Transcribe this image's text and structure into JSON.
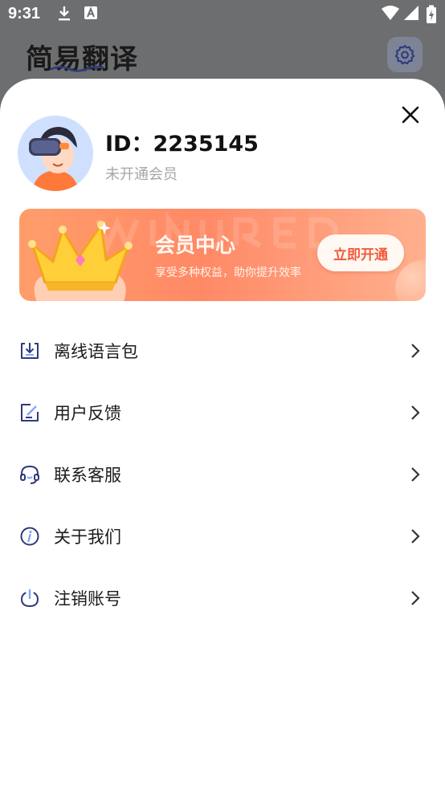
{
  "status_bar": {
    "time": "9:31",
    "icons": [
      "download-icon",
      "text-a-icon",
      "wifi-icon",
      "signal-icon",
      "battery-charging-icon"
    ]
  },
  "app": {
    "title": "简易翻译",
    "settings_icon": "gear-icon"
  },
  "profile": {
    "id_label": "ID：2235145",
    "member_status": "未开通会员",
    "avatar_icon": "vr-avatar-icon"
  },
  "banner": {
    "title": "会员中心",
    "subtitle": "享受多种权益，助你提升效率",
    "button_label": "立即开通",
    "crown_icon": "crown-icon",
    "colors": {
      "start": "#ff9d6a",
      "end": "#ffb08e",
      "button_text": "#f25a3a"
    }
  },
  "menu": {
    "items": [
      {
        "label": "离线语言包",
        "icon": "download-tray-icon"
      },
      {
        "label": "用户反馈",
        "icon": "edit-feedback-icon"
      },
      {
        "label": "联系客服",
        "icon": "headset-icon"
      },
      {
        "label": "关于我们",
        "icon": "info-icon"
      },
      {
        "label": "注销账号",
        "icon": "power-icon"
      }
    ]
  },
  "colors": {
    "accent": "#2f3a7a",
    "overlay": "#6d6e70"
  }
}
